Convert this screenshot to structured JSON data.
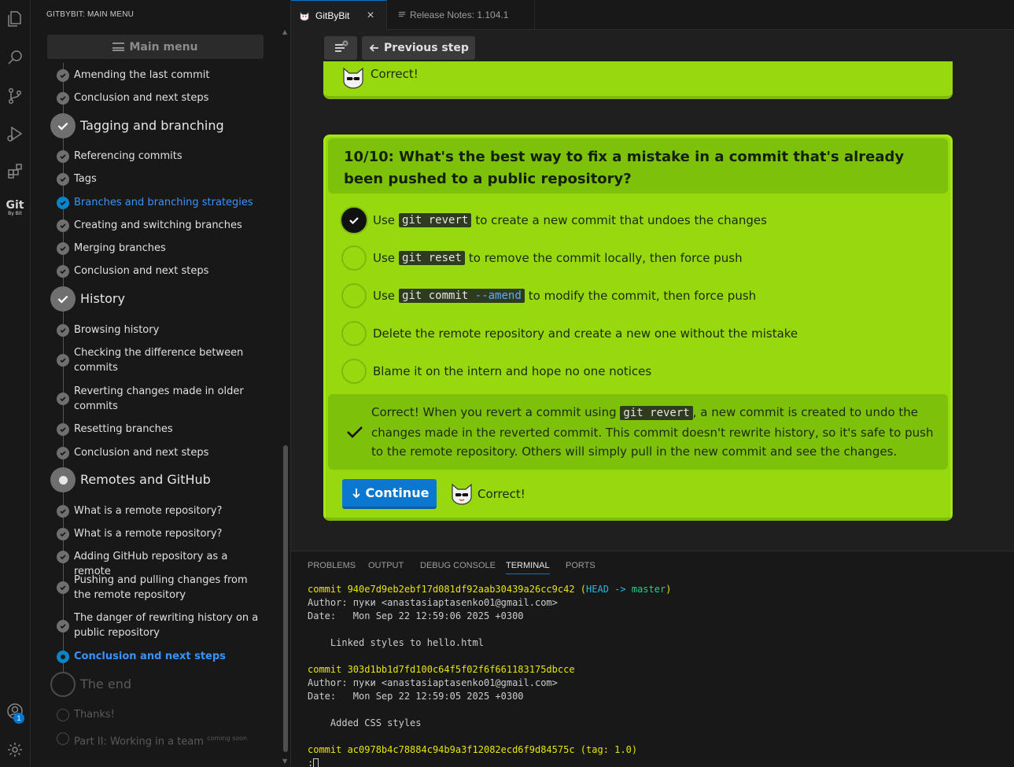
{
  "tabs": [
    {
      "label": "GitByBit",
      "close": "×"
    },
    {
      "label": "Release Notes: 1.104.1"
    }
  ],
  "sidebar": {
    "title": "GITBYBIT: MAIN MENU",
    "main_menu_label": "Main menu",
    "items": [
      {
        "label": "Amending the last commit"
      },
      {
        "label": "Conclusion and next steps"
      },
      {
        "label": "Tagging and branching"
      },
      {
        "label": "Referencing commits"
      },
      {
        "label": "Tags"
      },
      {
        "label": "Branches and branching strategies"
      },
      {
        "label": "Creating and switching branches"
      },
      {
        "label": "Merging branches"
      },
      {
        "label": "Conclusion and next steps"
      },
      {
        "label": "History"
      },
      {
        "label": "Browsing history"
      },
      {
        "label": "Checking the difference between commits"
      },
      {
        "label": "Reverting changes made in older commits"
      },
      {
        "label": "Resetting branches"
      },
      {
        "label": "Conclusion and next steps"
      },
      {
        "label": "Remotes and GitHub"
      },
      {
        "label": "What is a remote repository?"
      },
      {
        "label": "What is a remote repository?"
      },
      {
        "label": "Adding GitHub repository as a remote"
      },
      {
        "label": "Pushing and pulling changes from the remote repository"
      },
      {
        "label": "The danger of rewriting history on a public repository"
      },
      {
        "label": "Conclusion and next steps"
      },
      {
        "label": "The end"
      },
      {
        "label": "Thanks!"
      },
      {
        "label": "Part II: Working in a team",
        "note": "coming soon"
      }
    ]
  },
  "activity": {
    "git_logo": "Git",
    "git_logo_sub": "By Bit",
    "accounts_badge": "1"
  },
  "toolbar": {
    "previous_label": "Previous step"
  },
  "prev_card": {
    "correct": "Correct!"
  },
  "question": {
    "title": "10/10: What's the best way to fix a mistake in a commit that's already been pushed to a public repository?",
    "options": [
      {
        "pre": "Use",
        "code": "git revert",
        "post": "to create a new commit that undoes the changes",
        "checked": true
      },
      {
        "pre": "Use",
        "code": "git reset",
        "post": "to remove the commit locally, then force push",
        "checked": false
      },
      {
        "pre": "Use",
        "code": "git commit",
        "code_flag": "--amend",
        "post": "to modify the commit, then force push",
        "checked": false
      },
      {
        "pre": "Delete the remote repository and create a new one without the mistake",
        "checked": false
      },
      {
        "pre": "Blame it on the intern and hope no one notices",
        "checked": false
      }
    ],
    "feedback": {
      "pre": "Correct! When you revert a commit using",
      "code": "git revert",
      "post": ", a new commit is created to undo the changes made in the reverted commit. This commit doesn't rewrite history, so it's safe to push to the remote repository. Others will simply pull in the new commit and see the changes."
    },
    "continue_label": "Continue",
    "correct": "Correct!"
  },
  "panel": {
    "tabs": [
      "PROBLEMS",
      "OUTPUT",
      "DEBUG CONSOLE",
      "TERMINAL",
      "PORTS"
    ],
    "active_tab": "TERMINAL"
  },
  "terminal": {
    "commits": [
      {
        "hash": "commit 940e7d9eb2ebf17d081df92aab30439a26cc9c42",
        "ref_open": "(",
        "head": "HEAD",
        "arrow": "->",
        "branch": "master",
        "ref_close": ")",
        "author": "Author: пуки <anastasiaptasenko01@gmail.com>",
        "date": "Date:   Mon Sep 22 12:59:06 2025 +0300",
        "message": "    Linked styles to hello.html"
      },
      {
        "hash": "commit 303d1bb1d7fd100c64f5f02f6f661183175dbcce",
        "author": "Author: пуки <anastasiaptasenko01@gmail.com>",
        "date": "Date:   Mon Sep 22 12:59:05 2025 +0300",
        "message": "    Added CSS styles"
      },
      {
        "hash": "commit ac0978b4c78884c94b9a3f12082ecd6f9d84575c",
        "tag": "(tag: 1.0)"
      }
    ],
    "prompt": ":"
  },
  "colors": {
    "accent": "#0078d4",
    "card_green": "#97d80f",
    "card_header": "#7ec10b",
    "link_blue": "#3794ff"
  },
  "icons": [
    "explorer-icon",
    "search-icon",
    "source-control-icon",
    "run-debug-icon",
    "extensions-icon",
    "gitbybit-logo",
    "accounts-icon",
    "settings-icon",
    "menu-icon",
    "arrow-left-icon",
    "arrow-down-icon",
    "check-icon",
    "cat-mascot-icon"
  ]
}
